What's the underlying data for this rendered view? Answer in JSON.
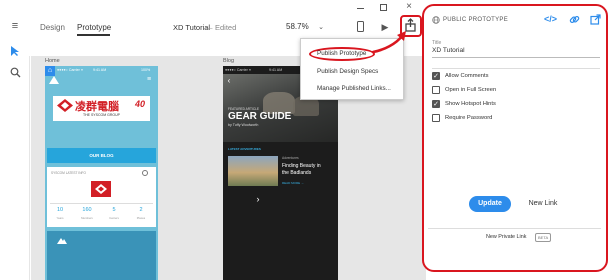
{
  "header": {
    "tabs": [
      {
        "label": "Design"
      },
      {
        "label": "Prototype"
      }
    ],
    "document_title": "XD Tutorial",
    "doc_status": "Edited",
    "zoom": "58.7%"
  },
  "artboards": {
    "home": {
      "label": "Home",
      "status_left": "●●●●○ Carrier ≡",
      "status_time": "9:41 AM",
      "status_right": "100%",
      "brand": "凌群電腦",
      "brand_sub": "THE SYSCOM GROUP",
      "badge": "40",
      "our_blog": "OUR BLOG",
      "card_title": "SYSCOM LATEST INFO",
      "stats": [
        {
          "value": "10",
          "label": "Years"
        },
        {
          "value": "160",
          "label": "Members"
        },
        {
          "value": "5",
          "label": "Centers"
        },
        {
          "value": "2",
          "label": "Places"
        }
      ]
    },
    "blog": {
      "label": "Blog",
      "status_left": "●●●●○ Carrier ≡",
      "status_time": "9:41 AM",
      "status_right": "100%",
      "featured": "FEATURED ARTICLE",
      "hero_title": "GEAR GUIDE",
      "byline": "by Tuffy Woolworth",
      "latest": "LATEST ADVENTURES",
      "post_tag": "Adventures",
      "post_title_1": "Finding Beauty in",
      "post_title_2": "the Badlands",
      "read_more": "READ MORE →"
    }
  },
  "menu": {
    "items": [
      {
        "label": "Publish Prototype"
      },
      {
        "label": "Publish Design Specs"
      },
      {
        "label": "Manage Published Links..."
      }
    ]
  },
  "panel": {
    "heading": "PUBLIC PROTOTYPE",
    "title_label": "Title",
    "title_value": "XD Tutorial",
    "options": [
      {
        "label": "Allow Comments",
        "checked": true
      },
      {
        "label": "Open in Full Screen",
        "checked": false
      },
      {
        "label": "Show Hotspot Hints",
        "checked": true
      },
      {
        "label": "Require Password",
        "checked": false
      }
    ],
    "update_label": "Update",
    "new_link_label": "New Link",
    "private_link_label": "New Private Link",
    "beta_label": "BETA"
  },
  "colors": {
    "accent_blue": "#2d8ceb",
    "highlight_red": "#d9161f",
    "syscom_red": "#d21f26",
    "blog_button": "#26a5db"
  },
  "icons": [
    "hamburger-icon",
    "select-arrow-icon",
    "zoom-icon",
    "device-icon",
    "play-icon",
    "share-icon",
    "globe-icon",
    "embed-icon",
    "link-icon",
    "open-external-icon",
    "minimize-icon",
    "maximize-icon",
    "close-icon"
  ]
}
